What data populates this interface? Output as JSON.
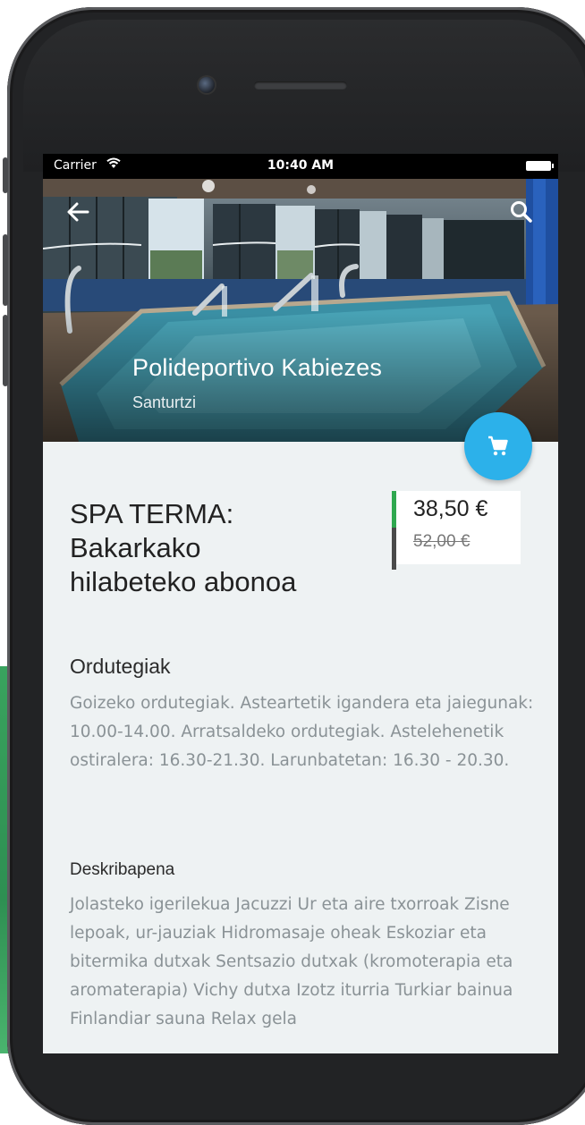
{
  "status_bar": {
    "carrier": "Carrier",
    "time": "10:40 AM"
  },
  "venue": {
    "name": "Polideportivo Kabiezes",
    "city": "Santurtzi"
  },
  "product": {
    "title_line1": "SPA TERMA:",
    "title_line2": "Bakarkako",
    "title_line3": "hilabeteko abonoa",
    "price": "38,50 €",
    "old_price": "52,00 €"
  },
  "sections": {
    "schedule": {
      "title": "Ordutegiak",
      "body": "Goizeko ordutegiak. Asteartetik igandera eta jaiegunak: 10.00-14.00.  Arratsaldeko ordutegiak. Astelehenetik ostiralera: 16.30-21.30. Larunbatetan: 16.30 - 20.30."
    },
    "description": {
      "title": "Deskribapena",
      "body": "Jolasteko igerilekua Jacuzzi Ur eta aire txorroak Zisne lepoak, ur-jauziak Hidromasaje oheak Eskoziar eta bitermika dutxak Sentsazio dutxak (kromoterapia eta aromaterapia) Vichy dutxa Izotz iturria Turkiar bainua Finlandiar sauna Relax gela"
    }
  },
  "colors": {
    "accent": "#2cb1ea",
    "price_current_bar": "#2fa84f",
    "price_old_bar": "#4a4a4a",
    "background": "#eef2f3"
  },
  "icons": {
    "back": "arrow-left-icon",
    "search": "search-icon",
    "cart": "shopping-cart-icon",
    "wifi": "wifi-icon",
    "battery": "battery-icon"
  }
}
